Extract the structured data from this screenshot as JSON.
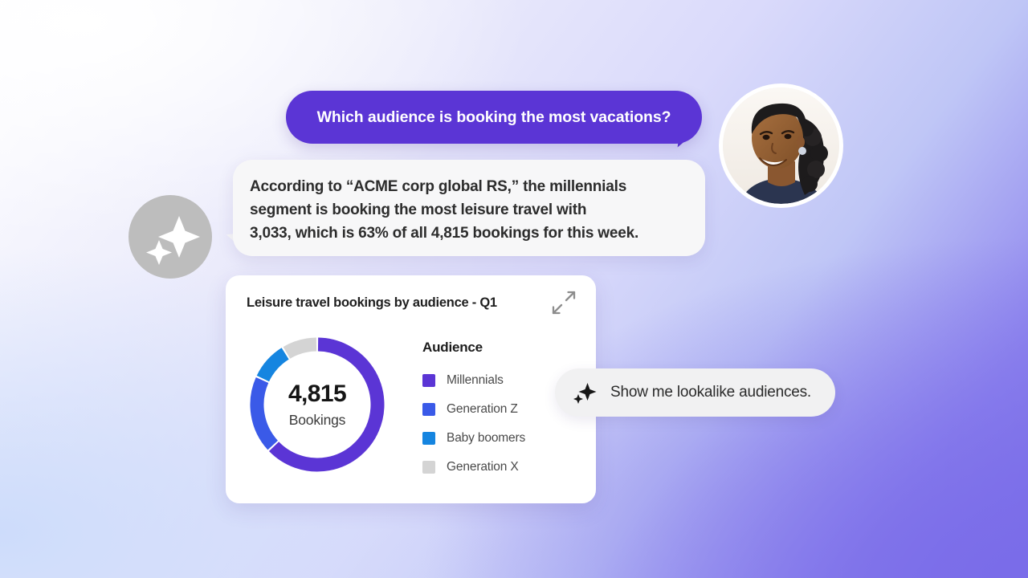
{
  "conversation": {
    "user_question": {
      "text": "Which audience is booking the most vacations?",
      "bubble_color": "#5b35d5",
      "text_color": "#ffffff"
    },
    "assistant_answer": {
      "lines": [
        "According to “ACME corp global RS,” the millennials",
        "segment is booking the most leisure travel with",
        "3,033, which is 63% of all 4,815 bookings for this week."
      ],
      "bubble_color": "#f7f7f8"
    },
    "assistant_avatar": {
      "icon": "sparkle-icon",
      "background_color": "#bdbdbd",
      "sparkle_color": "#ffffff"
    },
    "user_avatar": {
      "icon": "user-photo",
      "description": "Portrait photo of a smiling person"
    }
  },
  "chart_card": {
    "title": "Leisure travel bookings by audience - Q1",
    "expand_icon": "expand-arrows-icon",
    "center_value": "4,815",
    "center_label": "Bookings",
    "legend_title": "Audience"
  },
  "chart_data": {
    "type": "pie",
    "title": "Leisure travel bookings by audience - Q1",
    "center_value": "4,815",
    "center_label": "Bookings",
    "total": 4815,
    "legend_position": "right",
    "legend_title": "Audience",
    "categories": [
      "Millennials",
      "Generation Z",
      "Baby boomers",
      "Generation X"
    ],
    "values": [
      3033,
      910,
      453,
      419
    ],
    "percentages": [
      63,
      19,
      9.4,
      8.6
    ],
    "colors": [
      "#5b35d5",
      "#3a5ae8",
      "#1585e0",
      "#d4d4d4"
    ],
    "series": [
      {
        "name": "Bookings",
        "values": [
          3033,
          910,
          453,
          419
        ]
      }
    ],
    "donut": true,
    "start_angle": 0,
    "direction": "clockwise"
  },
  "suggestion_chip": {
    "icon": "sparkle-icon",
    "text": "Show me lookalike audiences.",
    "background_color": "#f1f1f2"
  },
  "background": {
    "gradient_from": "#ffffff",
    "gradient_mid": "#cddcfb",
    "gradient_to": "#7c6fe8"
  }
}
